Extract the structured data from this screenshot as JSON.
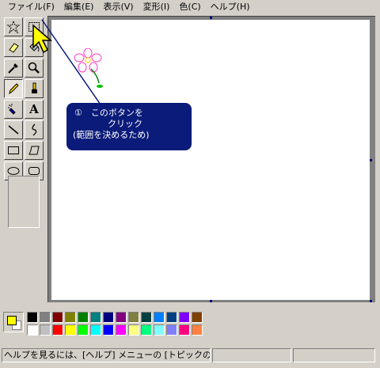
{
  "menubar": {
    "items": [
      "ファイル(F)",
      "編集(E)",
      "表示(V)",
      "変形(I)",
      "色(C)",
      "ヘルプ(H)"
    ]
  },
  "toolbox": {
    "tools": [
      {
        "name": "free-form-select-tool",
        "icon": "star-select-icon",
        "pressed": false
      },
      {
        "name": "rectangle-select-tool",
        "icon": "rect-select-icon",
        "pressed": false
      },
      {
        "name": "eraser-tool",
        "icon": "eraser-icon",
        "pressed": false
      },
      {
        "name": "fill-tool",
        "icon": "bucket-icon",
        "pressed": false
      },
      {
        "name": "pick-color-tool",
        "icon": "eyedropper-icon",
        "pressed": false
      },
      {
        "name": "magnifier-tool",
        "icon": "magnifier-icon",
        "pressed": false
      },
      {
        "name": "pencil-tool",
        "icon": "pencil-icon",
        "pressed": true
      },
      {
        "name": "brush-tool",
        "icon": "brush-icon",
        "pressed": false
      },
      {
        "name": "airbrush-tool",
        "icon": "airbrush-icon",
        "pressed": false
      },
      {
        "name": "text-tool",
        "icon": "text-a-icon",
        "pressed": false
      },
      {
        "name": "line-tool",
        "icon": "line-icon",
        "pressed": false
      },
      {
        "name": "curve-tool",
        "icon": "curve-icon",
        "pressed": false
      },
      {
        "name": "rectangle-tool",
        "icon": "rectangle-icon",
        "pressed": false
      },
      {
        "name": "polygon-tool",
        "icon": "polygon-icon",
        "pressed": false
      },
      {
        "name": "ellipse-tool",
        "icon": "ellipse-icon",
        "pressed": false
      },
      {
        "name": "rounded-rectangle-tool",
        "icon": "rounded-rect-icon",
        "pressed": false
      }
    ],
    "text_tool_glyph": "A"
  },
  "callout": {
    "line1": "①　このボタンを",
    "line2": "クリック",
    "line3": "(範囲を決めるため)"
  },
  "colors": {
    "foreground": "#ffff00",
    "background": "#ffffff",
    "palette": [
      "#000000",
      "#808080",
      "#800000",
      "#808000",
      "#008000",
      "#008080",
      "#000080",
      "#800080",
      "#808040",
      "#004040",
      "#0080ff",
      "#004080",
      "#8000ff",
      "#804000",
      "#ffffff",
      "#c0c0c0",
      "#ff0000",
      "#ffff00",
      "#00ff00",
      "#00ffff",
      "#0000ff",
      "#ff00ff",
      "#ffff80",
      "#00ff80",
      "#80ffff",
      "#8080ff",
      "#ff0080",
      "#ff8040"
    ]
  },
  "statusbar": {
    "help_text": "ヘルプを見るには、[ヘルプ] メニューの [トピックの検索] をクリックしてください。",
    "coords": "",
    "size": ""
  }
}
